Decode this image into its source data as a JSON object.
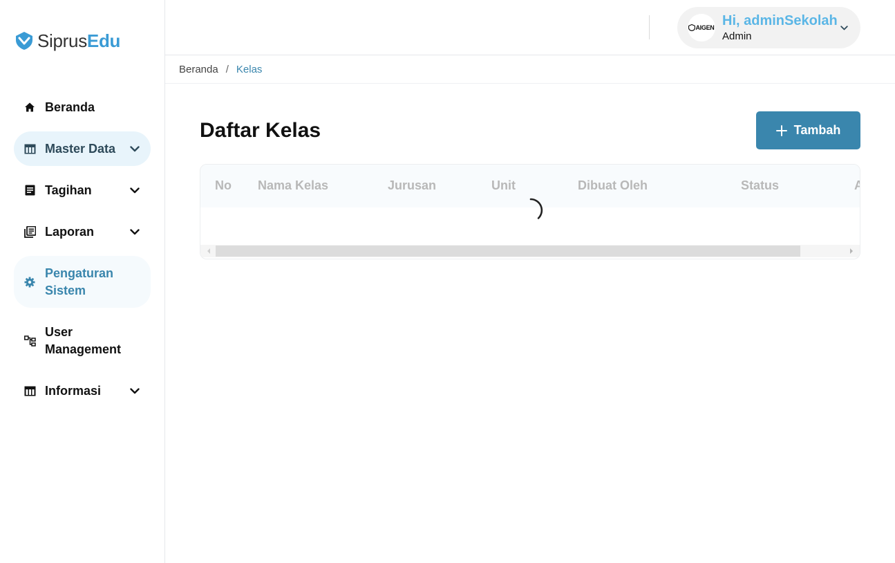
{
  "app": {
    "logo_part1": "Siprus",
    "logo_part2": "Edu",
    "accent_color": "#3a86ad",
    "brand_color": "#3a9bd5"
  },
  "sidebar": {
    "items": [
      {
        "label": "Beranda",
        "icon": "home-icon"
      },
      {
        "label": "Master Data",
        "icon": "table-icon",
        "expandable": true,
        "active": true
      },
      {
        "label": "Tagihan",
        "icon": "document-icon",
        "expandable": true
      },
      {
        "label": "Laporan",
        "icon": "report-icon",
        "expandable": true
      },
      {
        "label": "Pengaturan Sistem",
        "icon": "gear-icon"
      },
      {
        "label": "User Management",
        "icon": "hierarchy-icon"
      },
      {
        "label": "Informasi",
        "icon": "table-icon",
        "expandable": true
      }
    ]
  },
  "header": {
    "greeting": "Hi, adminSekolah",
    "role": "Admin",
    "avatar_text": "AIGEN"
  },
  "breadcrumb": {
    "home": "Beranda",
    "separator": "/",
    "current": "Kelas"
  },
  "main": {
    "title": "Daftar Kelas",
    "add_button_label": "Tambah",
    "table": {
      "columns": [
        "No",
        "Nama Kelas",
        "Jurusan",
        "Unit",
        "Dibuat Oleh",
        "Status",
        "A"
      ],
      "rows": [],
      "loading": true
    }
  }
}
